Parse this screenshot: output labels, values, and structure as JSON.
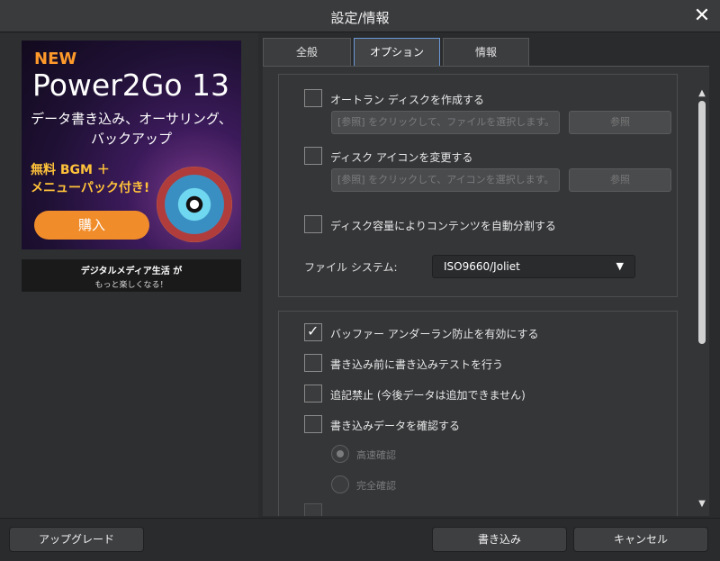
{
  "window": {
    "title": "設定/情報",
    "close_icon": "close-icon"
  },
  "ad": {
    "new": "NEW",
    "product": "Power2Go 13",
    "subtitle_line1": "データ書き込み、オーサリング、",
    "subtitle_line2": "バックアップ",
    "bgm_line1": "無料 BGM ＋",
    "bgm_line2": "メニューパック付き!",
    "buy_label": "購入",
    "tagline_line1": "デジタルメディア生活 が",
    "tagline_line2": "もっと楽しくなる！"
  },
  "tabs": [
    {
      "label": "全般",
      "active": false
    },
    {
      "label": "オプション",
      "active": true
    },
    {
      "label": "情報",
      "active": false
    }
  ],
  "options": {
    "autorun": {
      "label": "オートラン ディスクを作成する",
      "checked": false,
      "placeholder": "[参照] をクリックして、ファイルを選択します。",
      "browse": "参照"
    },
    "disc_icon": {
      "label": "ディスク アイコンを変更する",
      "checked": false,
      "placeholder": "[参照] をクリックして、アイコンを選択します。",
      "browse": "参照"
    },
    "auto_split": {
      "label": "ディスク容量によりコンテンツを自動分割する",
      "checked": false
    },
    "file_system": {
      "label": "ファイル システム:",
      "value": "ISO9660/Joliet"
    },
    "buffer_underrun": {
      "label": "バッファー アンダーラン防止を有効にする",
      "checked": true
    },
    "write_test": {
      "label": "書き込み前に書き込みテストを行う",
      "checked": false
    },
    "finalize": {
      "label": "追記禁止 (今後データは追加できません)",
      "checked": false
    },
    "verify": {
      "label": "書き込みデータを確認する",
      "checked": false
    },
    "verify_fast": {
      "label": "高速確認",
      "selected": true
    },
    "verify_full": {
      "label": "完全確認",
      "selected": false
    }
  },
  "buttons": {
    "upgrade": "アップグレード",
    "burn": "書き込み",
    "cancel": "キャンセル"
  },
  "scroll": {
    "up_icon": "▲",
    "down_icon": "▼"
  },
  "select_arrow": "▼"
}
